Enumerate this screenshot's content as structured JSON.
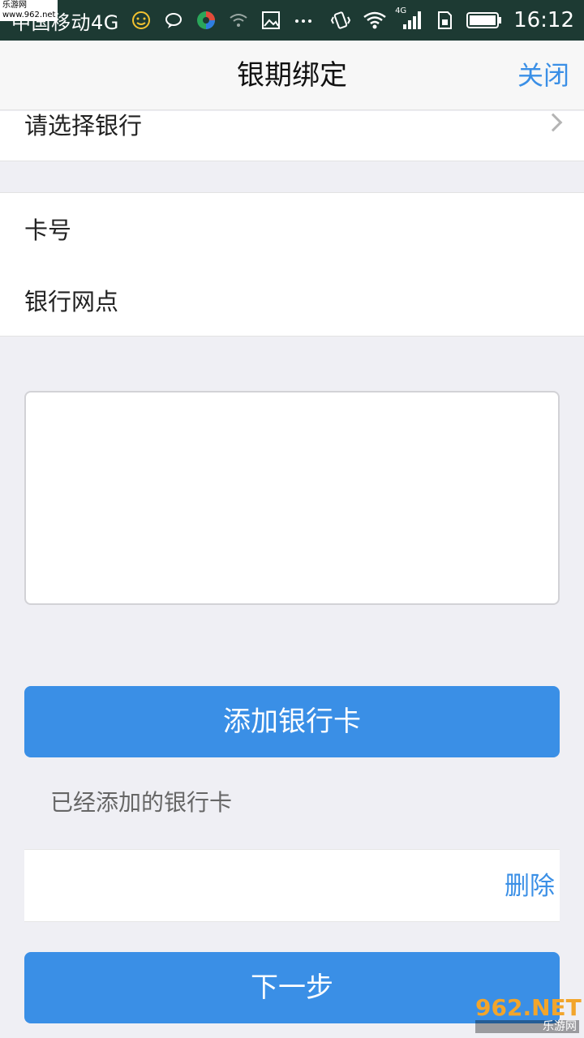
{
  "status_bar": {
    "carrier": "中国移动4G",
    "network_badge": "4G",
    "time": "16:12",
    "icons": [
      "smiley-icon",
      "chat-bubble-icon",
      "app-icon",
      "wifi-weak-icon",
      "image-icon",
      "more-dots-icon",
      "vibrate-icon",
      "wifi-icon",
      "signal-icon",
      "sim-icon",
      "battery-icon"
    ]
  },
  "watermark_top": {
    "line1": "乐游网",
    "line2": "www.962.net"
  },
  "nav": {
    "title": "银期绑定",
    "close_label": "关闭"
  },
  "bank_select": {
    "label": "请选择银行"
  },
  "card_form": {
    "card_number_label": "卡号",
    "branch_label": "银行网点"
  },
  "actions": {
    "add_card_label": "添加银行卡",
    "next_label": "下一步"
  },
  "added_cards": {
    "caption": "已经添加的银行卡",
    "delete_label": "删除"
  },
  "watermark_bottom": {
    "logo": "962.NET",
    "sub": "乐游网"
  },
  "colors": {
    "accent": "#3a8fe6",
    "status_bar": "#1d3a33",
    "background": "#efeff4"
  }
}
